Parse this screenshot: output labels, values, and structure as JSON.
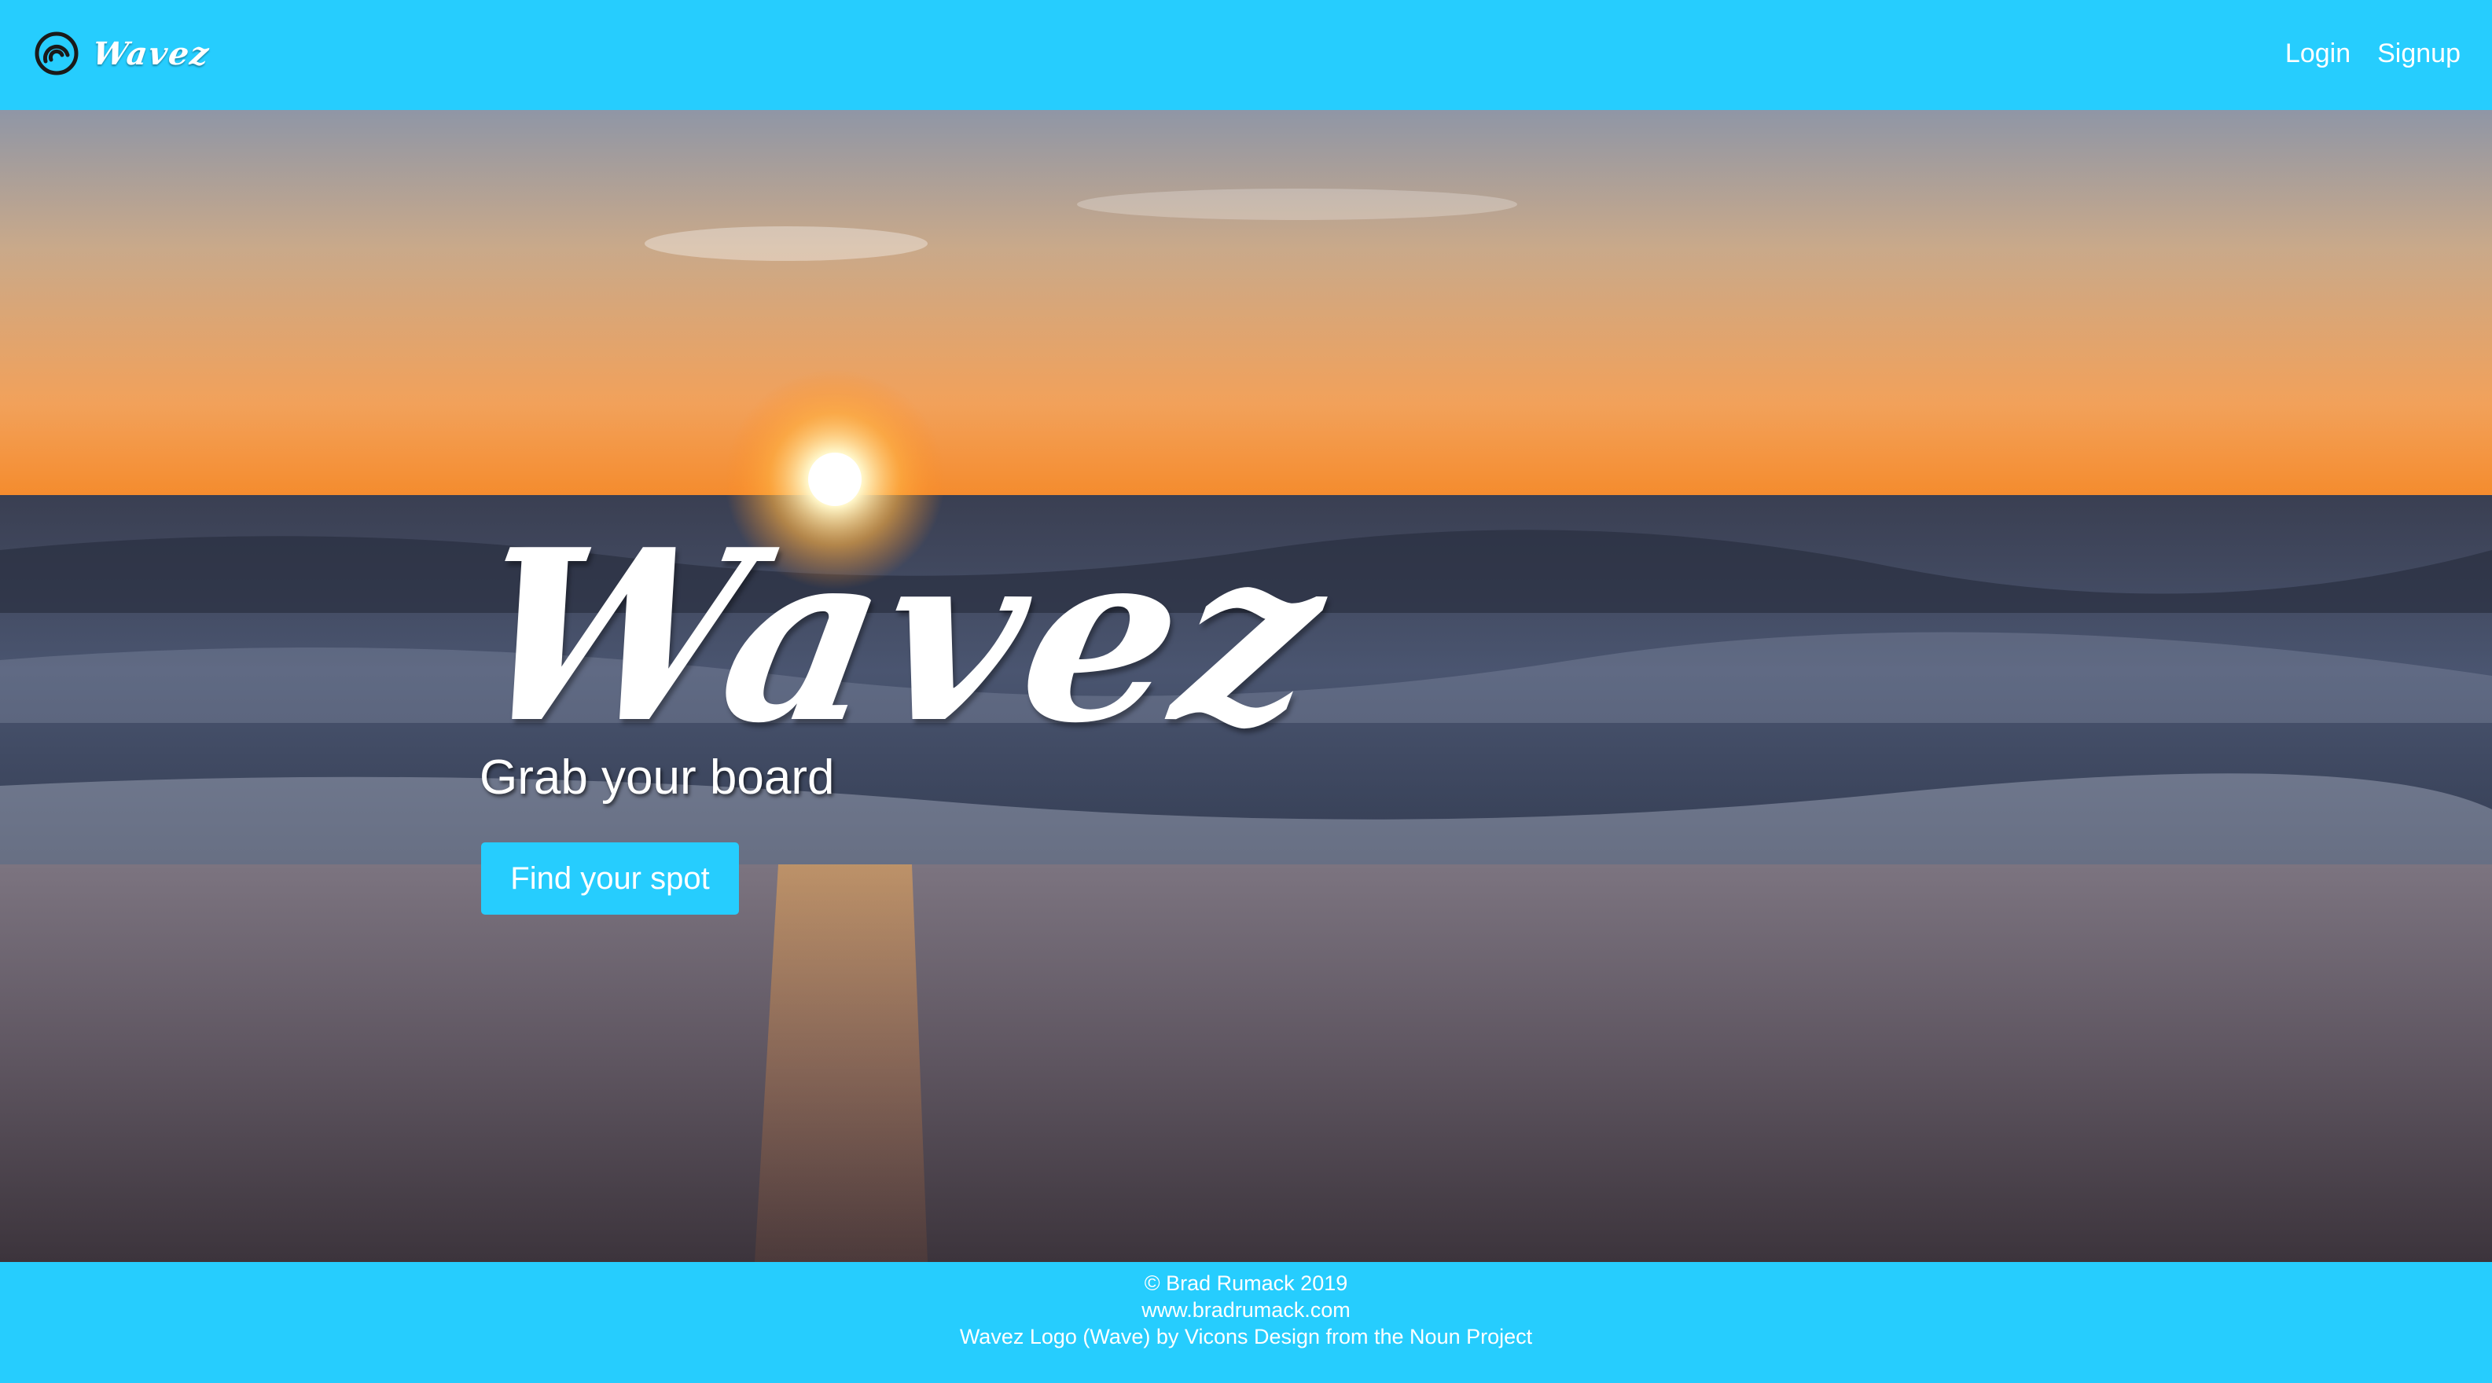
{
  "colors": {
    "accent": "#26cdfe",
    "text": "#ffffff"
  },
  "navbar": {
    "logo_icon": "wave-logo-icon",
    "brand_name": "Wavez",
    "links": [
      {
        "label": "Login"
      },
      {
        "label": "Signup"
      }
    ]
  },
  "hero": {
    "background": "beach-sunset-image",
    "title": "Wavez",
    "subtitle": "Grab your board",
    "button_label": "Find your spot"
  },
  "footer": {
    "copyright": "© Brad Rumack 2019",
    "website": "www.bradrumack.com",
    "credit": "Wavez Logo (Wave) by Vicons Design from the Noun Project"
  }
}
